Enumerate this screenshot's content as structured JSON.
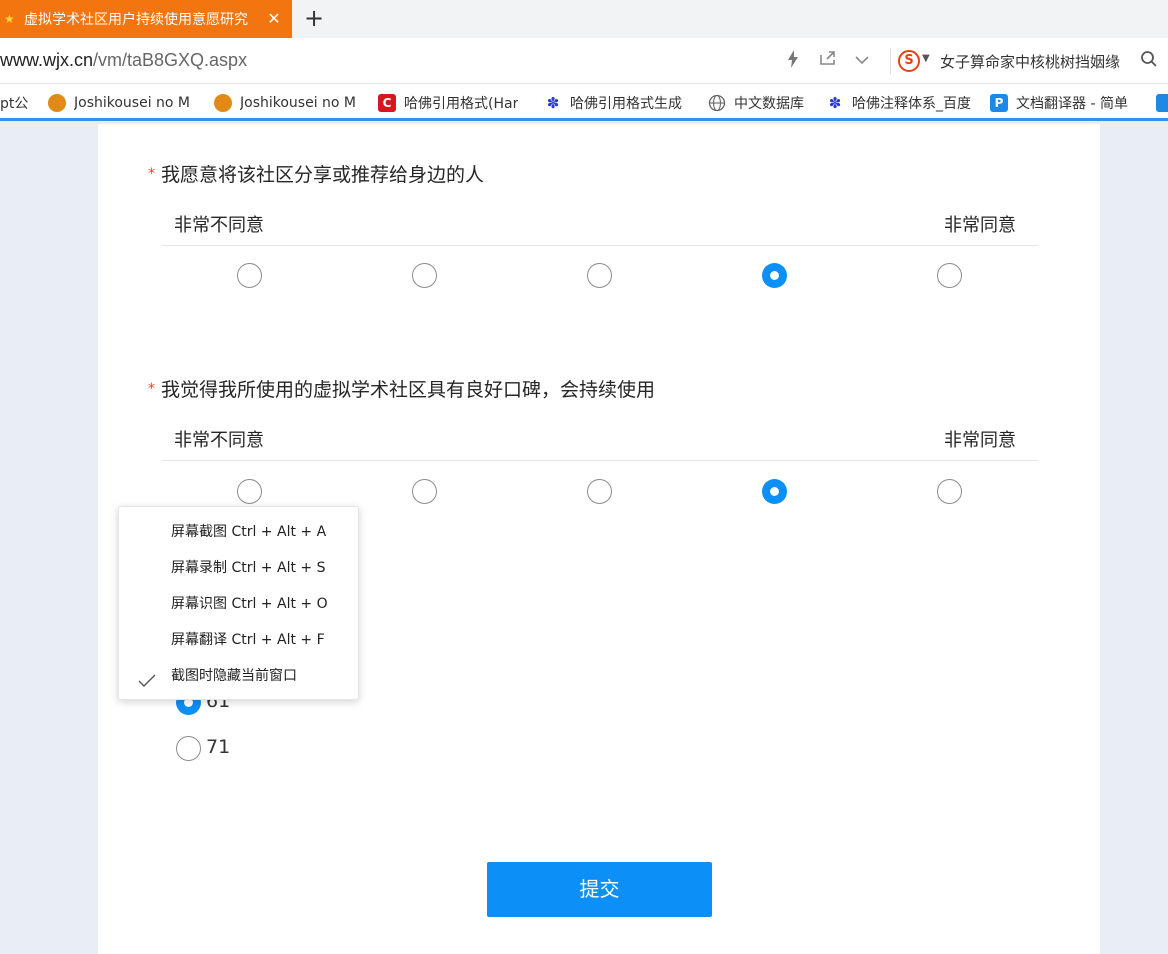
{
  "browser": {
    "tab": {
      "title": "虚拟学术社区用户持续使用意愿研究",
      "close_glyph": "✕"
    },
    "new_tab_glyph": "+",
    "address": {
      "host": "www.wjx.cn",
      "path": "/vm/taB8GXQ.aspx"
    },
    "search": {
      "text": "女子算命家中核桃树挡姻缘"
    },
    "bookmarks": [
      {
        "label": "pt公",
        "icon": "generic-icon"
      },
      {
        "label": "Joshikousei no M",
        "icon": "avatar-icon"
      },
      {
        "label": "Joshikousei no M",
        "icon": "avatar-icon"
      },
      {
        "label": "哈佛引用格式(Har",
        "icon": "c-logo-icon"
      },
      {
        "label": "哈佛引用格式生成",
        "icon": "baidu-paw-icon"
      },
      {
        "label": "中文数据库",
        "icon": "globe-icon"
      },
      {
        "label": "哈佛注释体系_百度",
        "icon": "baidu-paw-icon"
      },
      {
        "label": "文档翻译器 - 简单",
        "icon": "p-logo-icon"
      }
    ]
  },
  "survey": {
    "questions": [
      {
        "required_mark": "*",
        "title": "我愿意将该社区分享或推荐给身边的人",
        "low_label": "非常不同意",
        "high_label": "非常同意",
        "options_count": 5,
        "selected_index": 3
      },
      {
        "required_mark": "*",
        "title": "我觉得我所使用的虚拟学术社区具有良好口碑，会持续使用",
        "low_label": "非常不同意",
        "high_label": "非常同意",
        "options_count": 5,
        "selected_index": 3
      }
    ],
    "partial_question": {
      "options": [
        {
          "label": "61",
          "selected": true
        },
        {
          "label": "71",
          "selected": false
        }
      ]
    },
    "submit_label": "提交"
  },
  "context_menu": {
    "items": [
      {
        "label": "屏幕截图 Ctrl + Alt + A",
        "checked": false
      },
      {
        "label": "屏幕录制 Ctrl + Alt + S",
        "checked": false
      },
      {
        "label": "屏幕识图 Ctrl + Alt + O",
        "checked": false
      },
      {
        "label": "屏幕翻译 Ctrl + Alt + F",
        "checked": false
      },
      {
        "label": "截图时隐藏当前窗口",
        "checked": true
      }
    ]
  },
  "colors": {
    "tab_active": "#f3750f",
    "accent_blue": "#0c8ff6",
    "required_red": "#e8462d",
    "page_bg": "#e9eef5"
  }
}
